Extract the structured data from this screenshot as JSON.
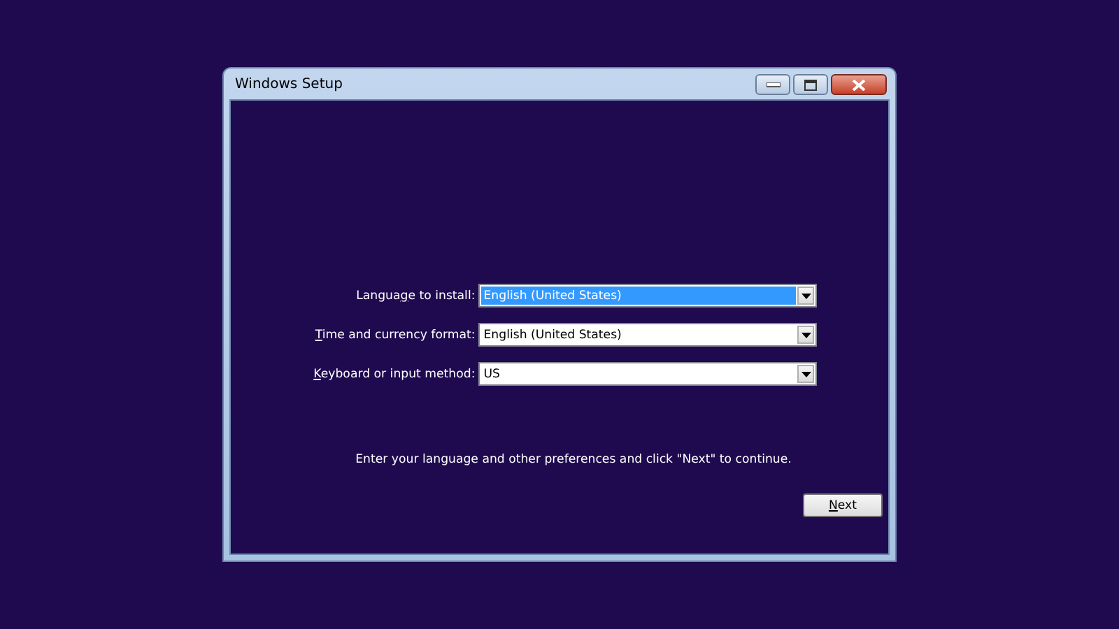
{
  "window": {
    "title": "Windows Setup"
  },
  "fields": [
    {
      "label": {
        "before": "Langua",
        "access_key": "g",
        "after": "e to install:"
      },
      "value": "English (United States)",
      "focused": true
    },
    {
      "label": {
        "access_key": "T",
        "after": "ime and currency format:"
      },
      "value": "English (United States)",
      "focused": false
    },
    {
      "label": {
        "access_key": "K",
        "after": "eyboard or input method:"
      },
      "value": "US",
      "focused": false
    }
  ],
  "message": "Enter your language and other preferences and click \"Next\" to continue.",
  "next_button": {
    "label": {
      "access_key": "N",
      "after": "ext"
    }
  }
}
